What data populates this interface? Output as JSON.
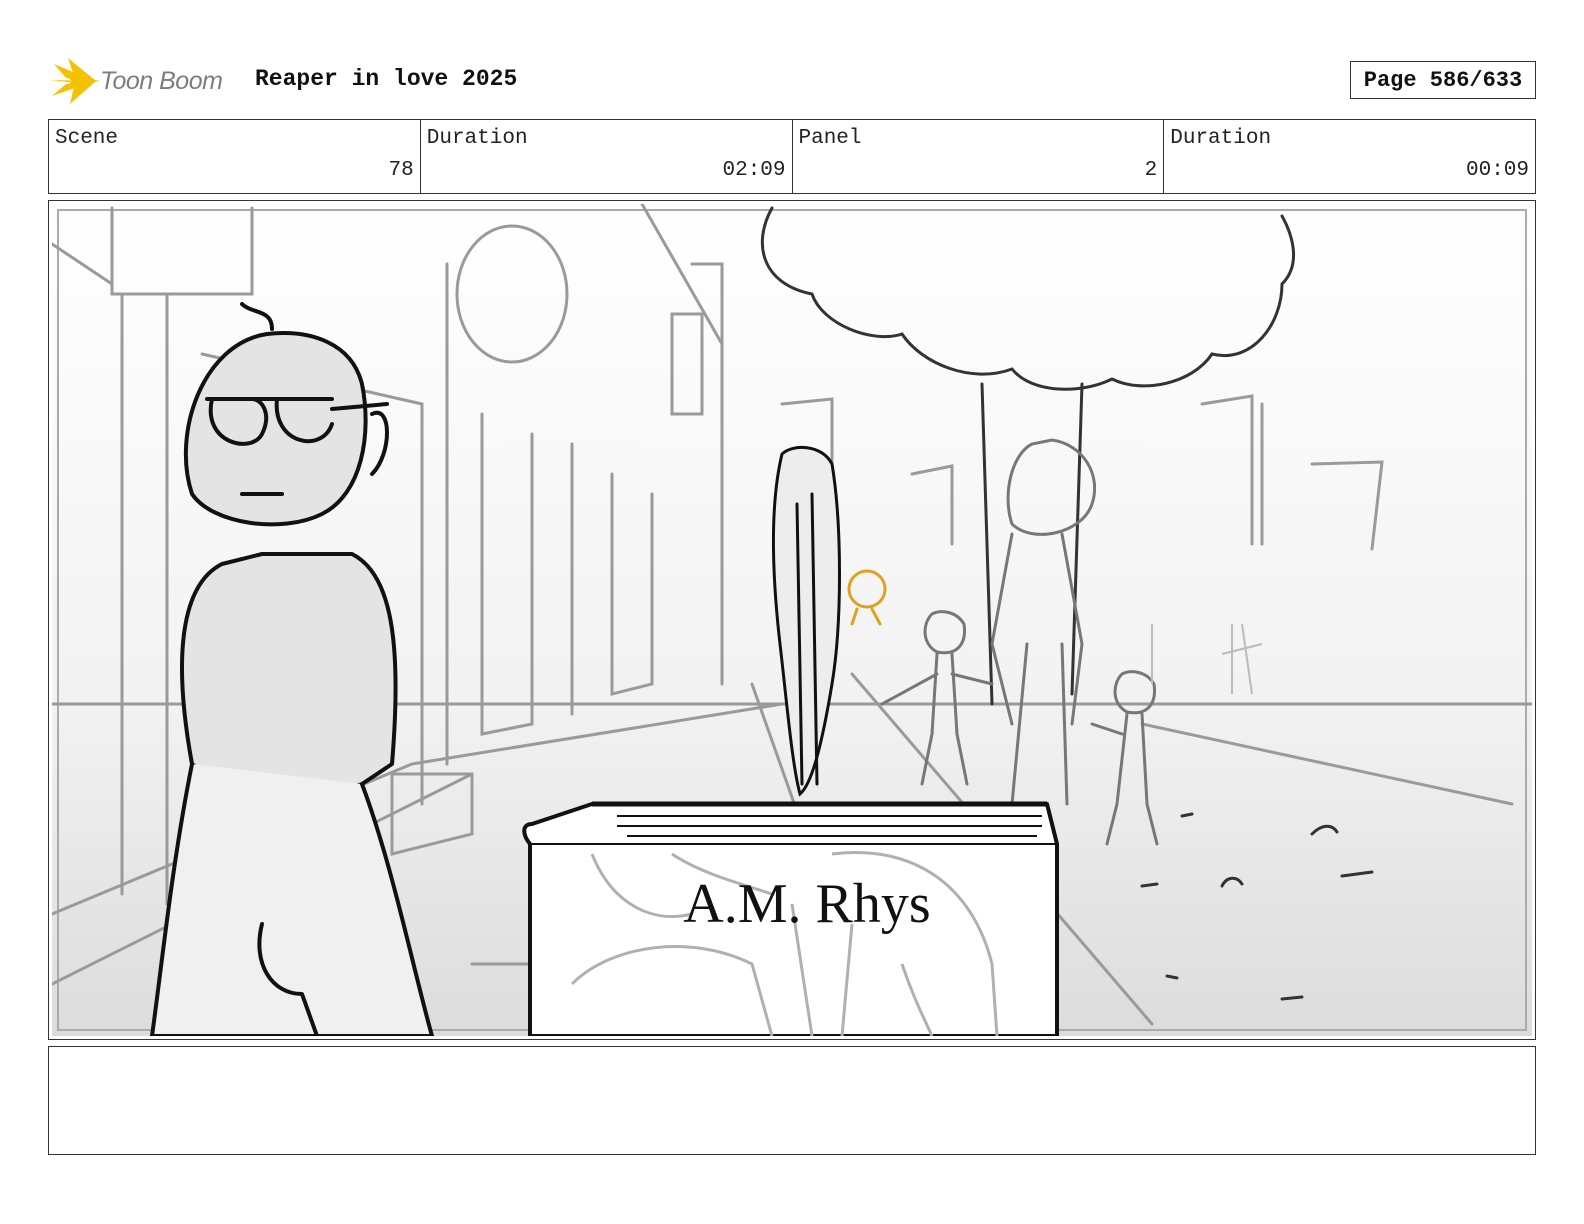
{
  "header": {
    "brand": "Toon Boom",
    "project_title": "Reaper in love 2025",
    "page": "Page 586/633"
  },
  "info": [
    {
      "label": "Scene",
      "value": "78"
    },
    {
      "label": "Duration",
      "value": "02:09"
    },
    {
      "label": "Panel",
      "value": "2"
    },
    {
      "label": "Duration",
      "value": "00:09"
    }
  ],
  "panel": {
    "book_cover_text": "A.M. Rhys"
  },
  "notes": {
    "text": ""
  },
  "colors": {
    "logo_yellow": "#f5c200",
    "logo_text": "#7b7d80",
    "sketch_gray": "#9a9a9a",
    "sketch_black": "#111111",
    "sketch_orange": "#e0a020"
  }
}
